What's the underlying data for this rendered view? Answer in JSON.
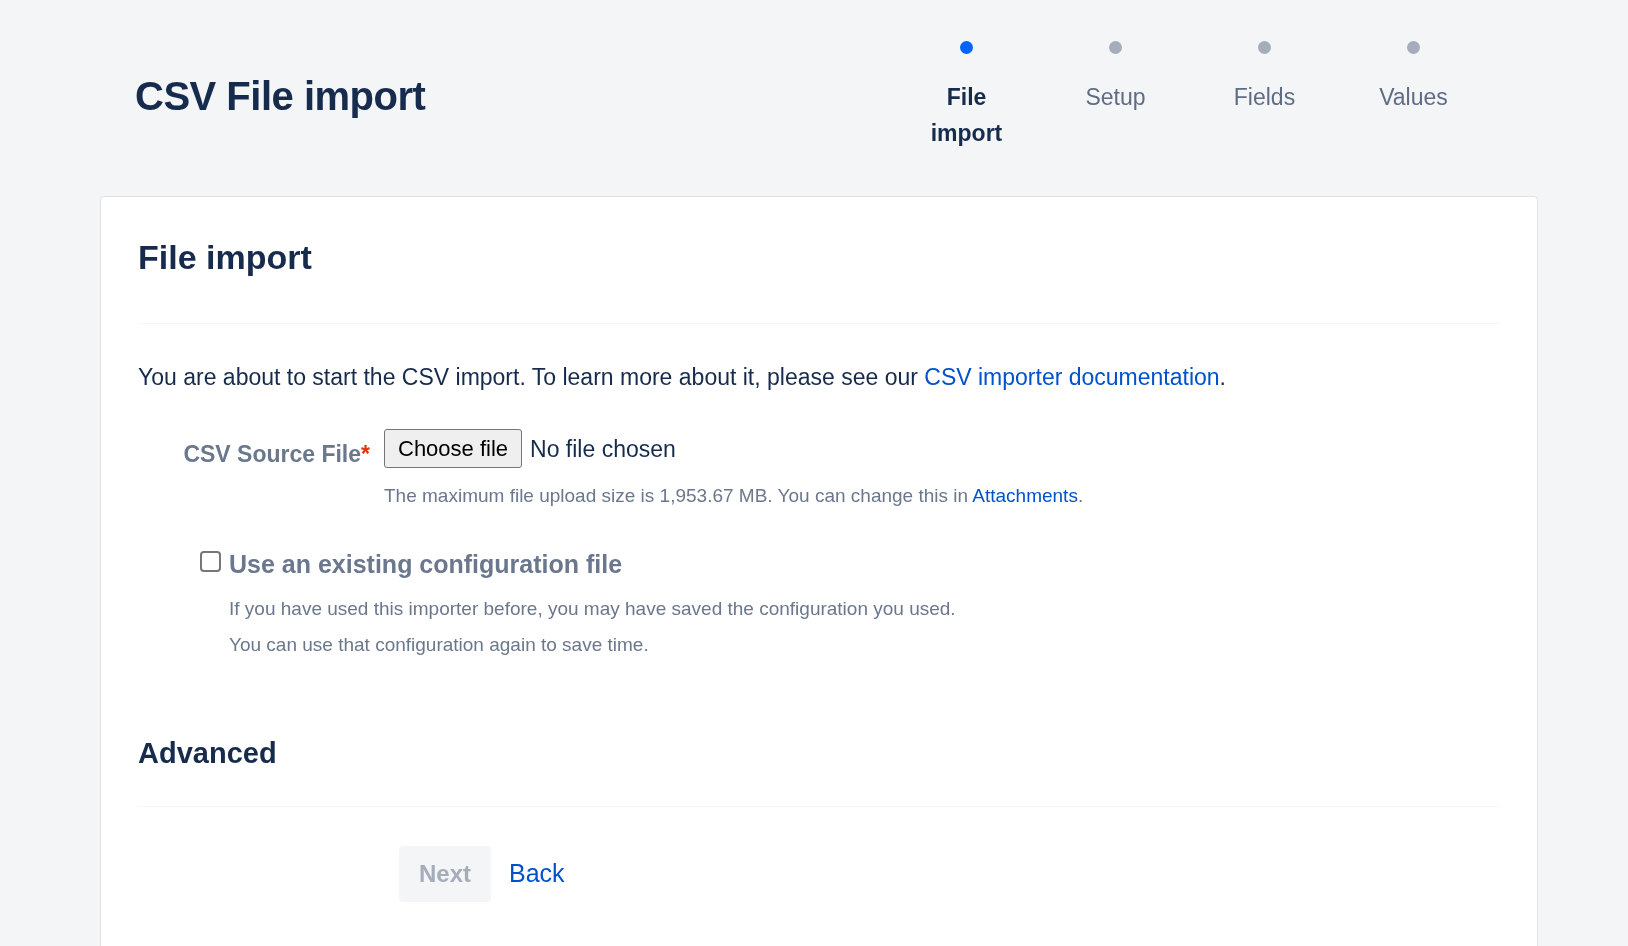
{
  "page_title": "CSV File import",
  "steps": [
    {
      "label": "File import",
      "selected": true
    },
    {
      "label": "Setup",
      "selected": false
    },
    {
      "label": "Fields",
      "selected": false
    },
    {
      "label": "Values",
      "selected": false
    }
  ],
  "panel": {
    "title": "File import",
    "intro": {
      "text": "You are about to start the CSV import. To learn more about it, please see our ",
      "link": "CSV importer documentation",
      "after": "."
    },
    "source_file": {
      "label": "CSV Source File",
      "required": true,
      "required_mark": "*",
      "button": "Choose file",
      "value": "No file chosen",
      "help": {
        "text": "The maximum file upload size is 1,953.67 MB. You can change this in ",
        "link": "Attachments",
        "after": "."
      }
    },
    "config_checkbox": {
      "label": "Use an existing configuration file",
      "checked": false,
      "description": [
        "If you have used this importer before, you may have saved the configuration you used.",
        "You can use that configuration again to save time."
      ]
    },
    "advanced_title": "Advanced",
    "buttons": [
      {
        "label": "Next",
        "kind": "button",
        "disabled": true
      },
      {
        "label": "Back",
        "kind": "link",
        "disabled": false
      }
    ]
  }
}
